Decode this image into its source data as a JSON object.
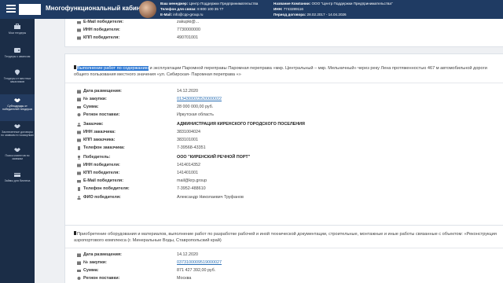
{
  "app": {
    "title": "Многофункциональный кабинет"
  },
  "header": {
    "manager_label": "Ваш менеджер:",
    "manager_value": "Центр Поддержки Предпринимательства",
    "phone_label": "Телефон для связи:",
    "phone_value": "8 800 100 35 77",
    "email_label": "E-Mail:",
    "email_value": "info@cpp-group.ru",
    "company_label": "Название Компании:",
    "company_value": "ООО \"Центр Поддержки Предпринимательства\"",
    "inn_label": "ИНН:",
    "inn_value": "7743289116",
    "period_label": "Период договора:",
    "period_value": "28.02.2017 - 14.04.2026"
  },
  "sidebar": {
    "items": [
      {
        "label": "Мои тендеры",
        "icon": "briefcase-icon"
      },
      {
        "label": "Тендеры с авансом",
        "icon": "wallet-icon"
      },
      {
        "label": "Тендеры от местных заказчиков",
        "icon": "location-icon"
      },
      {
        "label": "Субподряды от победителей тендеров",
        "icon": "handshake-icon"
      },
      {
        "label": "Заключенные договоры по заявкам в госзакупках",
        "icon": "contract-icon"
      },
      {
        "label": "Поиск клиентов по заявкам",
        "icon": "clients-icon"
      },
      {
        "label": "Займы для бизнеса",
        "icon": "loan-icon"
      }
    ],
    "active_index": 3
  },
  "cards": [
    {
      "partial": true,
      "rows": [
        {
          "label": "E-Mail победителя:",
          "value": "zakupki@...",
          "type": "text"
        },
        {
          "label": "ИНН победителя:",
          "value": "7730000000",
          "type": "text"
        },
        {
          "label": "КПП победителя:",
          "value": "490701001",
          "type": "text"
        }
      ]
    },
    {
      "title_highlight": "Выполнение работ по содержанию",
      "title_rest": " и эксплуатации Паромной переправы Паромная переправа «мкр. Центральный – мкр. Мельничный» через реку Лена протяженностью 467 м автомобильной дороги общего пользования местного значения «ул. Сибирская- Паромная переправа «»",
      "rows": [
        {
          "label": "Дата размещения:",
          "value": "14.12.2020",
          "type": "text"
        },
        {
          "label": "№ закупки:",
          "value": "0134300023520000022",
          "type": "link"
        },
        {
          "label": "Сумма:",
          "value": "28 000 000,00 руб.",
          "type": "text"
        },
        {
          "label": "Регион поставки:",
          "value": "Иркутская область",
          "type": "text"
        },
        {
          "label": "Заказчик:",
          "value": "АДМИНИСТРАЦИЯ КИРЕНСКОГО ГОРОДСКОГО ПОСЕЛЕНИЯ",
          "type": "bold"
        },
        {
          "label": "ИНН заказчика:",
          "value": "3831004024",
          "type": "text"
        },
        {
          "label": "КПП заказчика:",
          "value": "383101001",
          "type": "text"
        },
        {
          "label": "Телефон заказчика:",
          "value": "7-39568-43351",
          "type": "text"
        },
        {
          "label": "Победитель:",
          "value": "ООО \"КИРЕНСКИЙ РЕЧНОЙ ПОРТ\"",
          "type": "bold"
        },
        {
          "label": "ИНН победителя:",
          "value": "1414014352",
          "type": "text"
        },
        {
          "label": "КПП победителя:",
          "value": "141401001",
          "type": "text"
        },
        {
          "label": "E-Mail победителя:",
          "value": "mail@krp.group",
          "type": "text"
        },
        {
          "label": "Телефон победителя:",
          "value": "7-3952-488610",
          "type": "text"
        },
        {
          "label": "ФИО победителя:",
          "value": "Александр Николаевич Труфанов",
          "type": "text"
        }
      ]
    },
    {
      "title_highlight": "",
      "title_rest": "Приобретение оборудования и материалов, выполнение работ по разработке рабочей и иной технической документации, строительные, монтажные и иные работы связанные с объектом: «Реконструкция аэропортового комплекса (г. Минеральные Воды, Ставропольский край)",
      "rows": [
        {
          "label": "Дата размещения:",
          "value": "14.12.2020",
          "type": "text"
        },
        {
          "label": "№ закупки:",
          "value": "0373100009519000027",
          "type": "link"
        },
        {
          "label": "Сумма:",
          "value": "871 427 392,00 руб.",
          "type": "text"
        },
        {
          "label": "Регион поставки:",
          "value": "Москва",
          "type": "text"
        }
      ]
    }
  ],
  "colors": {
    "topbar": "#1f3b63",
    "sidebar": "#1b2d47",
    "link": "#2a6fb5",
    "highlight": "#2f79d3"
  }
}
